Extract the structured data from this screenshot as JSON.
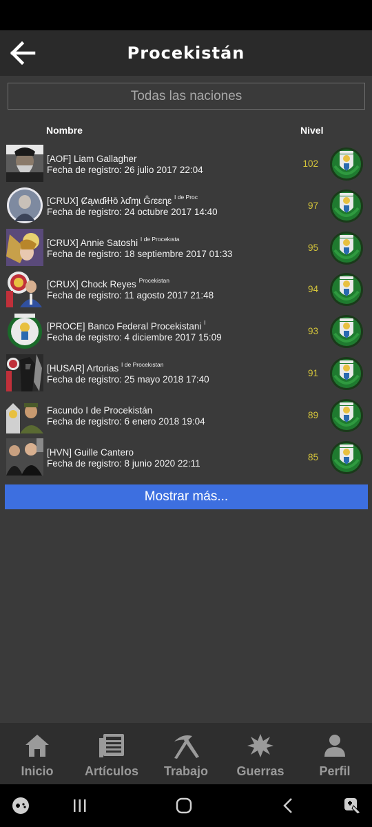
{
  "header": {
    "title": "Procekistán"
  },
  "filter": {
    "label": "Todas las naciones"
  },
  "columns": {
    "name": "Nombre",
    "level": "Nivel"
  },
  "members": [
    {
      "name": "[AOF] Liam Gallagher",
      "suffix": "",
      "date": "Fecha de registro: 26 julio 2017 22:04",
      "level": "102",
      "avatar": "bearded-man-avatar"
    },
    {
      "name": "[CRUX] Ȼąʍɗɨɫɫō λďɱɩ Ĝɾɛɛɳɛ",
      "suffix": "I de Proc",
      "date": "Fecha de registro: 24 octubre 2017 14:40",
      "level": "97",
      "avatar": "portrait-avatar"
    },
    {
      "name": "[CRUX] Annie Satoshi",
      "suffix": "I de Procekısta",
      "date": "Fecha de registro: 18 septiembre 2017 01:33",
      "level": "95",
      "avatar": "anime-avatar"
    },
    {
      "name": "[CRUX] Chock Reyes",
      "suffix": "Procekistan",
      "date": "Fecha de registro: 11 agosto 2017 21:48",
      "level": "94",
      "avatar": "suit-man-avatar"
    },
    {
      "name": "[PROCE] Banco Federal Procekistani",
      "suffix": "I",
      "date": "Fecha de registro: 4 diciembre 2017 15:09",
      "level": "93",
      "avatar": "bank-emblem-avatar"
    },
    {
      "name": "[HUSAR] Artorias",
      "suffix": "I de Procekıstan",
      "date": "Fecha de registro: 25 mayo 2018 17:40",
      "level": "91",
      "avatar": "knight-avatar"
    },
    {
      "name": "Facundo I de Procekistán",
      "suffix": "",
      "date": "Fecha de registro: 6 enero 2018 19:04",
      "level": "89",
      "avatar": "soldier-avatar"
    },
    {
      "name": "[HVN] Guille Cantero",
      "suffix": "",
      "date": "Fecha de registro: 8 junio 2020 22:11",
      "level": "85",
      "avatar": "crowd-avatar"
    }
  ],
  "more_button": {
    "label": "Mostrar más..."
  },
  "nav": [
    {
      "label": "Inicio",
      "icon": "home-icon"
    },
    {
      "label": "Artículos",
      "icon": "newspaper-icon"
    },
    {
      "label": "Trabajo",
      "icon": "pickaxe-icon"
    },
    {
      "label": "Guerras",
      "icon": "explosion-icon"
    },
    {
      "label": "Perfil",
      "icon": "person-icon"
    }
  ],
  "colors": {
    "accent": "#3d6fe0",
    "level": "#d6c63a",
    "header_bg": "#2a2a2a",
    "page_bg": "#3a3a3a"
  }
}
